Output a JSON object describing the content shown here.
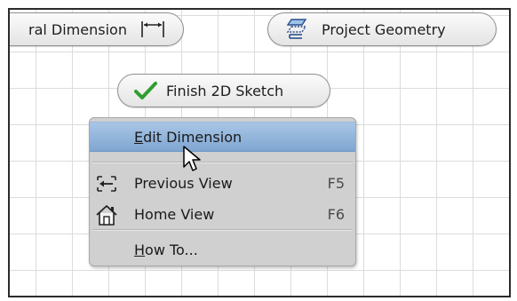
{
  "toolbar": {
    "dimension_label": "ral Dimension",
    "dimension_icon": "horizontal-dimension-icon",
    "project_geometry_label": "Project Geometry",
    "project_geometry_icon": "project-geometry-icon",
    "finish_sketch_label": "Finish 2D Sketch",
    "finish_sketch_icon": "green-checkmark-icon"
  },
  "context_menu": {
    "items": [
      {
        "label_accel": "E",
        "label_rest": "dit Dimension",
        "shortcut": "",
        "icon": "",
        "highlighted": true
      },
      {
        "label_accel": "",
        "label_rest": "Previous View",
        "shortcut": "F5",
        "icon": "previous-view-icon",
        "highlighted": false
      },
      {
        "label_accel": "",
        "label_rest": "Home View",
        "shortcut": "F6",
        "icon": "home-view-icon",
        "highlighted": false
      },
      {
        "label_accel": "H",
        "label_rest": "ow To...",
        "shortcut": "",
        "icon": "",
        "highlighted": false
      }
    ]
  },
  "colors": {
    "highlight": "#8fb2db",
    "menu_background": "#d0d0d0",
    "checkmark": "#2f9e2f",
    "grid": "#dcdcdc"
  }
}
